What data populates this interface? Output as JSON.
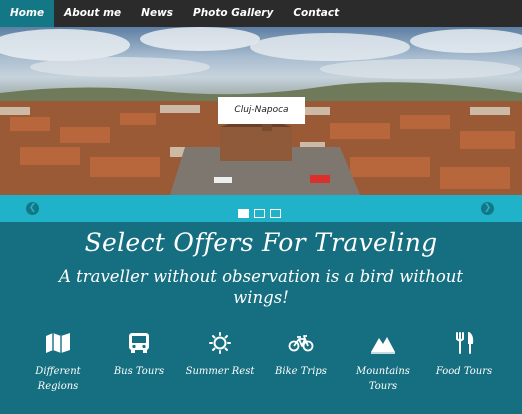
{
  "nav": {
    "items": [
      {
        "label": "Home",
        "active": true
      },
      {
        "label": "About me",
        "active": false
      },
      {
        "label": "News",
        "active": false
      },
      {
        "label": "Photo Gallery",
        "active": false
      },
      {
        "label": "Contact",
        "active": false
      }
    ]
  },
  "hero": {
    "caption": "Cluj-Napoca"
  },
  "slider": {
    "prev_icon": "chevron-left-icon",
    "next_icon": "chevron-right-icon",
    "slide_count": 3,
    "active_index": 0
  },
  "main": {
    "headline": "Select Offers For Traveling",
    "tagline": "A traveller without observation is a bird without wings!"
  },
  "features": [
    {
      "label": "Different Regions",
      "icon": "map-icon"
    },
    {
      "label": "Bus Tours",
      "icon": "bus-icon"
    },
    {
      "label": "Summer Rest",
      "icon": "sun-icon"
    },
    {
      "label": "Bike Trips",
      "icon": "bicycle-icon"
    },
    {
      "label": "Mountains Tours",
      "icon": "mountain-icon"
    },
    {
      "label": "Food Tours",
      "icon": "cutlery-icon"
    }
  ],
  "colors": {
    "nav_bg": "#2b2b2b",
    "nav_active": "#137786",
    "slider_bar": "#1fb2c9",
    "main_bg": "#166f80"
  }
}
